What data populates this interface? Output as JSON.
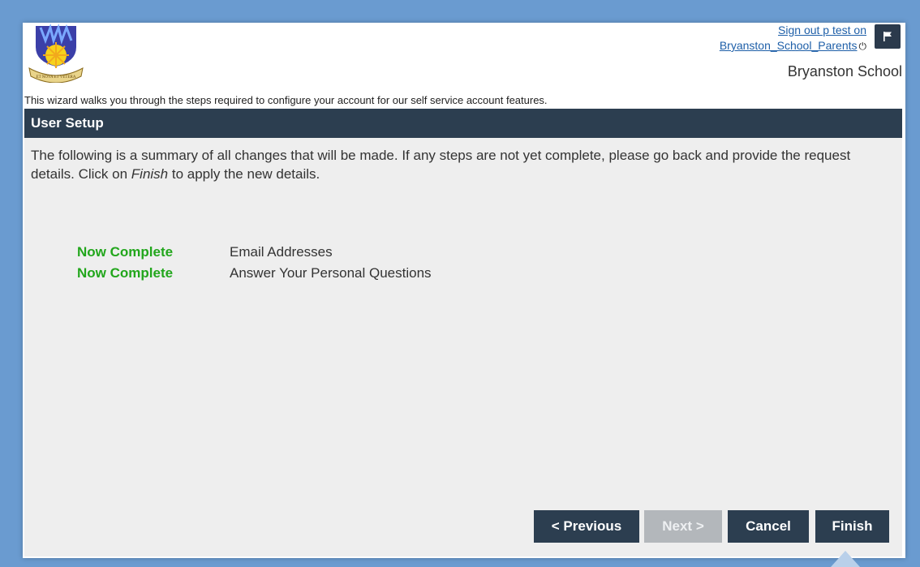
{
  "header": {
    "sign_out_line1": "Sign out p test on",
    "sign_out_line2": "Bryanston_School_Parents",
    "power_icon": "⏻",
    "org_name": "Bryanston School",
    "logo_motto": "ET NOVA ET VETERA"
  },
  "intro_text": "This wizard walks you through the steps required to configure your account for our self service account features.",
  "panel": {
    "title": "User Setup",
    "summary_part1": "The following is a summary of all changes that will be made. If any steps are not yet complete, please go back and provide the request details. Click on ",
    "summary_emphasis": "Finish",
    "summary_part2": " to apply the new details.",
    "steps": [
      {
        "status": "Now Complete",
        "label": "Email Addresses"
      },
      {
        "status": "Now Complete",
        "label": "Answer Your Personal Questions"
      }
    ]
  },
  "buttons": {
    "previous": "< Previous",
    "next": "Next >",
    "cancel": "Cancel",
    "finish": "Finish"
  },
  "colors": {
    "header_bg": "#2c3e50",
    "complete": "#22a61c",
    "link": "#1e5fa8",
    "background": "#6a9bd0"
  }
}
